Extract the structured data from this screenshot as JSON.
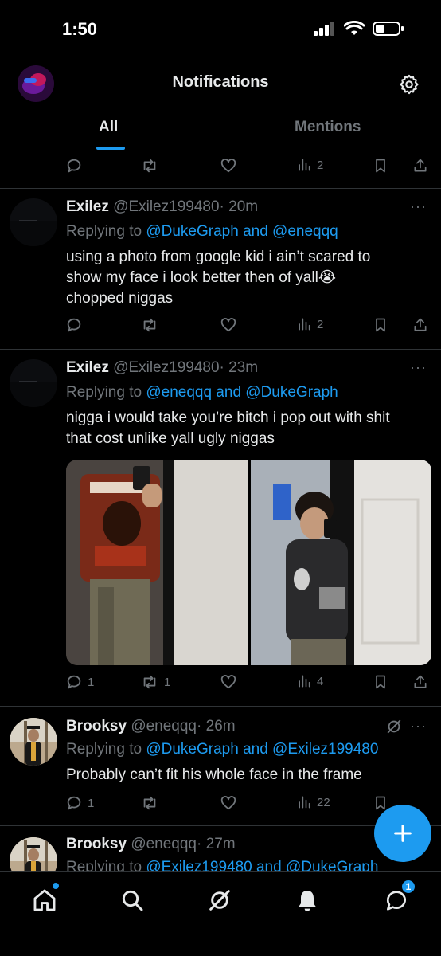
{
  "status": {
    "time": "1:50"
  },
  "header": {
    "title": "Notifications"
  },
  "tabs": [
    {
      "label": "All",
      "active": true
    },
    {
      "label": "Mentions",
      "active": false
    }
  ],
  "top_partial_actions": {
    "replies": "",
    "reposts": "",
    "views": "2"
  },
  "tweets": [
    {
      "name": "Exilez",
      "handle": "@Exilez199480",
      "time": "· 20m",
      "replying_prefix": "Replying to",
      "replying_to": "@DukeGraph and @eneqqq",
      "text_lines": [
        "using a photo from google kid i ain’t scared to",
        "show my face i look better then of yall😭",
        "chopped niggas"
      ],
      "replies": "",
      "reposts": "",
      "views": "2"
    },
    {
      "name": "Exilez",
      "handle": "@Exilez199480",
      "time": "· 23m",
      "replying_prefix": "Replying to",
      "replying_to": "@eneqqq and @DukeGraph",
      "text_lines": [
        "nigga i would take you’re bitch i pop out with shit",
        "that cost unlike yall ugly niggas"
      ],
      "replies": "1",
      "reposts": "1",
      "views": "4"
    },
    {
      "name": "Brooksy",
      "handle": "@eneqqq",
      "time": "· 26m",
      "replying_prefix": "Replying to",
      "replying_to": "@DukeGraph and @Exilez199480",
      "text_lines": [
        "Probably can’t fit his whole face in the frame"
      ],
      "replies": "1",
      "reposts": "",
      "views": "22"
    },
    {
      "name": "Brooksy",
      "handle": "@eneqqq",
      "time": "· 27m",
      "replying_prefix": "Replying to",
      "replying_to": "@Exilez199480 and @DukeGraph"
    }
  ],
  "nav": {
    "messages_badge": "1"
  },
  "colors": {
    "accent": "#1d9bf0",
    "background": "#000000",
    "muted": "#71767b",
    "text": "#e7e9ea",
    "divider": "#2f3336"
  }
}
